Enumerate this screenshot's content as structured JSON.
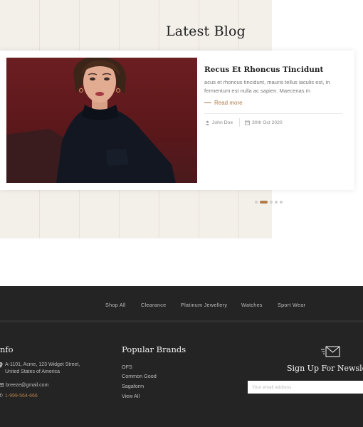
{
  "blog": {
    "section_title": "Latest Blog",
    "post": {
      "title": "Recus Et Rhoncus Tincidunt",
      "excerpt": "acus et rhoncus tincidunt, mauris tellus iaculis est, in fermentum est nulla ac sapien. Maecenas m",
      "read_more": "Read more",
      "author": "John Doe",
      "date": "30th Oct 2020"
    },
    "carousel": {
      "total_dots": 5,
      "active_index": 1
    }
  },
  "footer": {
    "nav": [
      "Shop All",
      "Clearance",
      "Platinum Jewellery",
      "Watches",
      "Sport Wear"
    ],
    "info": {
      "heading": "nfo",
      "address_line1": "A-1101, Acme, 123 Widget Street,",
      "address_line2": "United States of America",
      "email": "breeze@gmail.com",
      "phone": "1-999-564-666"
    },
    "brands": {
      "heading": "Popular Brands",
      "items": [
        "OFS",
        "Common Good",
        "Sagaform",
        "View All"
      ]
    },
    "newsletter": {
      "heading": "Sign Up For Newslet",
      "placeholder": "Your email address"
    }
  },
  "colors": {
    "accent": "#b27c4a",
    "footer_bg": "#242424",
    "blog_bg": "#f3efe9"
  }
}
